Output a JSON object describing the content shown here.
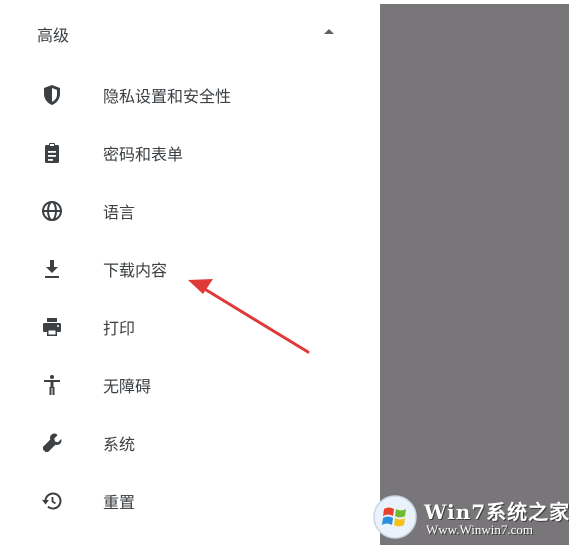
{
  "section": {
    "title": "高级",
    "expanded": true
  },
  "menu": {
    "items": [
      {
        "label": "隐私设置和安全性",
        "icon": "shield-icon"
      },
      {
        "label": "密码和表单",
        "icon": "clipboard-icon"
      },
      {
        "label": "语言",
        "icon": "globe-icon"
      },
      {
        "label": "下载内容",
        "icon": "download-icon"
      },
      {
        "label": "打印",
        "icon": "printer-icon"
      },
      {
        "label": "无障碍",
        "icon": "accessibility-icon"
      },
      {
        "label": "系统",
        "icon": "wrench-icon"
      },
      {
        "label": "重置",
        "icon": "restore-icon"
      }
    ]
  },
  "colors": {
    "text": "#3c4043",
    "icon": "#3c4043",
    "arrow": "#e0393a",
    "right_pane": "#787679"
  },
  "watermark": {
    "brand": "Win7系统之家",
    "url": "Www.Winwin7.com"
  }
}
